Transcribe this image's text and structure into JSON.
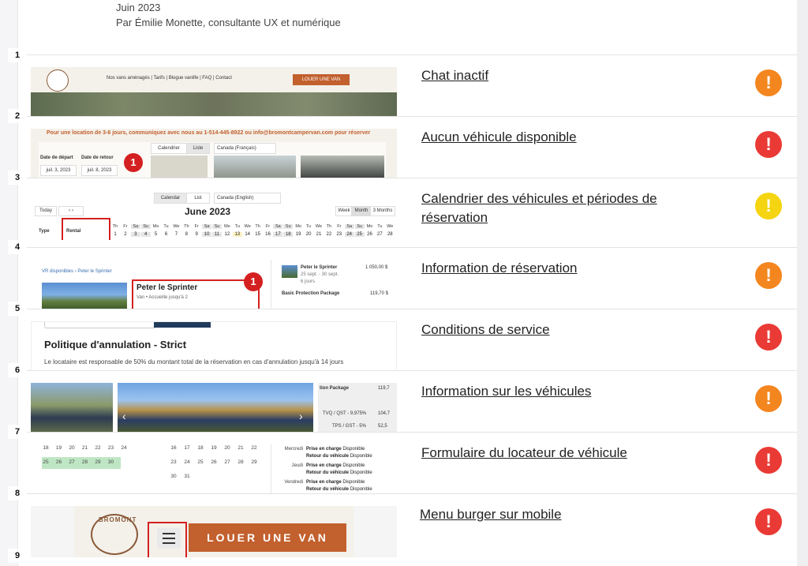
{
  "header": {
    "date": "Juin 2023",
    "author": "Par Émilie Monette, consultante UX et numérique"
  },
  "numbers": [
    "1",
    "2",
    "3",
    "4",
    "5",
    "6",
    "7",
    "8",
    "9"
  ],
  "rows": [
    {
      "title": "Chat inactif",
      "severity": "orange",
      "icon": "!"
    },
    {
      "title": "Aucun véhicule disponible",
      "severity": "red",
      "icon": "!"
    },
    {
      "title": "Calendrier des véhicules et périodes de réservation",
      "severity": "yellow",
      "icon": "!"
    },
    {
      "title": "Information de réservation",
      "severity": "orange",
      "icon": "!"
    },
    {
      "title": "Conditions de service",
      "severity": "red",
      "icon": "!"
    },
    {
      "title": "Information sur les véhicules",
      "severity": "orange",
      "icon": "!"
    },
    {
      "title": "Formulaire du locateur de véhicule",
      "severity": "red",
      "icon": "!"
    },
    {
      "title": "Menu burger sur mobile",
      "severity": "red",
      "icon": "!"
    }
  ],
  "colors": {
    "orange": "#f4861f",
    "red": "#ea3a35",
    "yellow": "#f5d411"
  },
  "thumb1": {
    "nav_links": "Nos vans aménagés  |  Tarifs  |  Blogue vanlife  |  FAQ  |  Contact",
    "cta": "LOUER UNE VAN"
  },
  "thumb2": {
    "banner": "Pour une location de 3-6 jours, communiquez avec nous au 1-514-445-8922 ou info@bromontcampervan.com pour réserver",
    "tab_calendar": "Calendrier",
    "tab_list": "Liste",
    "lang": "Canada (Français)",
    "depart_label": "Date de départ",
    "retour_label": "Date de retour",
    "depart_val": "juil. 3, 2023",
    "retour_val": "juil. 8, 2023",
    "marker": "1"
  },
  "thumb3": {
    "tab_calendar": "Calendar",
    "tab_list": "List",
    "lang": "Canada (English)",
    "today": "Today",
    "month": "June 2023",
    "view_week": "Week",
    "view_month": "Month",
    "view_3m": "3 Months",
    "col_type": "Type",
    "col_rental": "Rental",
    "days": [
      "Th",
      "Fr",
      "Sa",
      "Su",
      "Mo",
      "Tu",
      "We",
      "Th",
      "Fr",
      "Sa",
      "Su",
      "Mo",
      "Tu",
      "We",
      "Th",
      "Fr",
      "Sa",
      "Su",
      "Mo",
      "Tu",
      "We",
      "Th",
      "Fr",
      "Sa",
      "Su",
      "Mo",
      "Tu",
      "We"
    ],
    "dates": [
      "1",
      "2",
      "3",
      "4",
      "5",
      "6",
      "7",
      "8",
      "9",
      "10",
      "11",
      "12",
      "13",
      "14",
      "15",
      "16",
      "17",
      "18",
      "19",
      "20",
      "21",
      "22",
      "23",
      "24",
      "25",
      "26",
      "27",
      "28"
    ]
  },
  "thumb4": {
    "breadcrumb": "VR disponibles  ›  Peter le Sprinter",
    "name": "Peter le Sprinter",
    "sub": "Van • Accueille jusqu'à 2",
    "marker": "1",
    "side_name": "Peter le Sprinter",
    "side_dates": "25 sept. - 30 sept.",
    "side_nights": "6 jours",
    "side_price": "1 050,00 $",
    "package": "Basic Protection Package",
    "package_price": "119,70 $"
  },
  "thumb5": {
    "heading": "Politique d'annulation - Strict",
    "text": "Le locataire est responsable de 50% du montant total de la réservation en cas d'annulation jusqu'à 14 jours"
  },
  "thumb6": {
    "package": "tion Package",
    "package_price": "119,7",
    "tvq": "TVQ / QST - 9,975%",
    "tvq_val": "104,7",
    "tps": "TPS / GST - 5%",
    "tps_val": "52,5"
  },
  "thumb7": {
    "left_rows": [
      [
        "18",
        "19",
        "20",
        "21",
        "22",
        "23",
        "24"
      ],
      [
        "25",
        "26",
        "27",
        "28",
        "29",
        "30"
      ]
    ],
    "mid_rows": [
      [
        "16",
        "17",
        "18",
        "19",
        "20",
        "21",
        "22"
      ],
      [
        "23",
        "24",
        "25",
        "26",
        "27",
        "28",
        "29"
      ],
      [
        "30",
        "31"
      ]
    ],
    "days": [
      {
        "day": "Mercredi",
        "l1": "Prise en charge",
        "s1": "Disponible",
        "l2": "Retour du véhicule",
        "s2": "Disponible"
      },
      {
        "day": "Jeudi",
        "l1": "Prise en charge",
        "s1": "Disponible",
        "l2": "Retour du véhicule",
        "s2": "Disponible"
      },
      {
        "day": "Vendredi",
        "l1": "Prise en charge",
        "s1": "Disponible",
        "l2": "Retour du véhicule",
        "s2": "Disponible"
      }
    ]
  },
  "thumb8": {
    "logo": "BROMONT",
    "cta": "LOUER UNE VAN"
  }
}
